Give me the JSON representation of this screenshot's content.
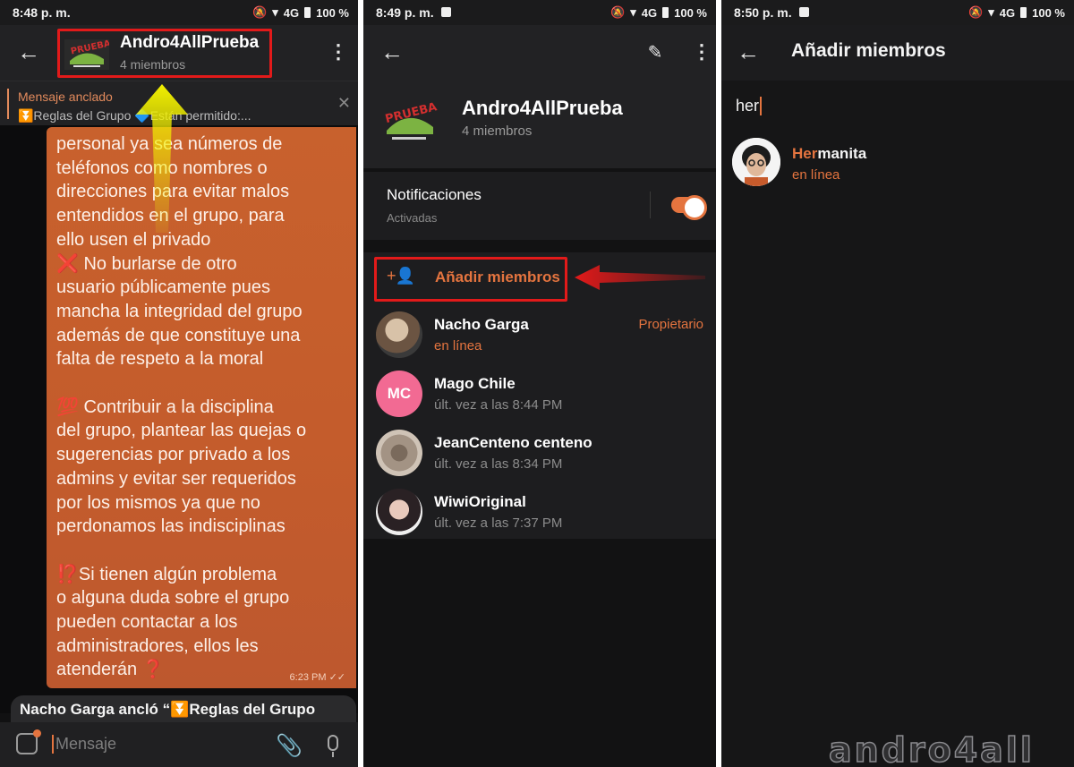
{
  "panel1": {
    "status": {
      "time": "8:48 p. m.",
      "network": "4G",
      "battery": "100 %"
    },
    "chat": {
      "title": "Andro4AllPrueba",
      "subtitle": "4 miembros"
    },
    "pinned": {
      "label": "Mensaje anclado",
      "preview": "⏬Reglas del Grupo 🔷Están permitido:..."
    },
    "message": {
      "text": "personal ya sea números de\nteléfonos como nombres o\ndirecciones para evitar malos\nentendidos en el grupo, para\nello usen el privado\n      ❌ No burlarse de otro\nusuario públicamente pues\nmancha la integridad del grupo\nademás de que constituye una\nfalta de respeto a la moral\n\n      💯 Contribuir a la disciplina\ndel grupo, plantear las quejas o\nsugerencias por privado a los\nadmins y evitar ser requeridos\npor los mismos ya que no\nperdonamos las indisciplinas\n\n⁉️Si tienen algún problema\no alguna duda sobre el grupo\npueden contactar a los\nadministradores, ellos les\natenderán ❓",
      "time": "6:23 PM"
    },
    "service": "Nacho Garga ancló “⏬Reglas del Grupo",
    "input_placeholder": "Mensaje"
  },
  "panel2": {
    "status": {
      "time": "8:49 p. m.",
      "network": "4G",
      "battery": "100 %"
    },
    "group": {
      "name": "Andro4AllPrueba",
      "members": "4 miembros"
    },
    "notifications": {
      "label": "Notificaciones",
      "state": "Activadas",
      "enabled": true
    },
    "add_members": {
      "label": "Añadir miembros",
      "icon": "add-person-icon"
    },
    "members": [
      {
        "name": "Nacho Garga",
        "status": "en línea",
        "online": true,
        "role": "Propietario"
      },
      {
        "name": "Mago Chile",
        "status": "últ. vez a las 8:44 PM",
        "online": false,
        "initials": "MC"
      },
      {
        "name": "JeanCenteno centeno",
        "status": "últ. vez a las 8:34 PM",
        "online": false
      },
      {
        "name": "WiwiOriginal",
        "status": "últ. vez a las 7:37 PM",
        "online": false
      }
    ]
  },
  "panel3": {
    "status": {
      "time": "8:50 p. m.",
      "network": "4G",
      "battery": "100 %"
    },
    "title": "Añadir miembros",
    "search": "her",
    "result": {
      "name_match": "Her",
      "name_rest": "manita",
      "status": "en línea"
    },
    "watermark": "ANDRO4ALL"
  },
  "colors": {
    "accent": "#e4743f",
    "highlight": "#e21a1a",
    "bubble": "#c45c2c",
    "background": "#111112"
  }
}
